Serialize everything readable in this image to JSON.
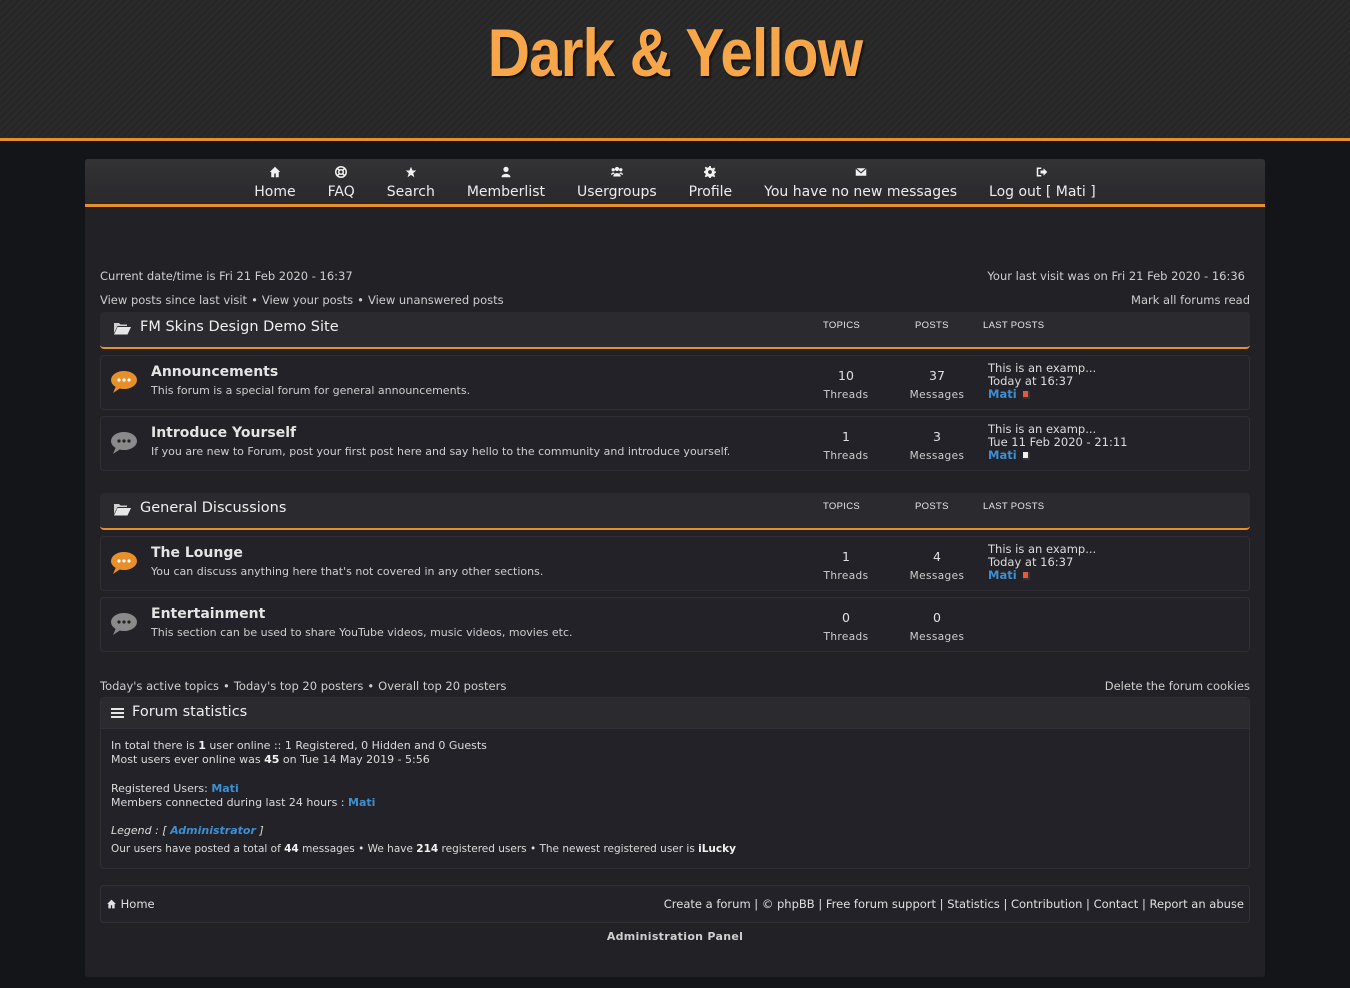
{
  "site": {
    "title": "Dark & Yellow",
    "accent_color": "#e78f2a",
    "title_color": "#f7a64a",
    "link_color": "#3d8fd1"
  },
  "nav": [
    {
      "label": "Home",
      "icon": "home-icon"
    },
    {
      "label": "FAQ",
      "icon": "lifebuoy-icon"
    },
    {
      "label": "Search",
      "icon": "star-icon"
    },
    {
      "label": "Memberlist",
      "icon": "user-icon"
    },
    {
      "label": "Usergroups",
      "icon": "users-icon"
    },
    {
      "label": "Profile",
      "icon": "gear-icon"
    },
    {
      "label": "You have no new messages",
      "icon": "envelope-icon"
    },
    {
      "label": "Log out [ Mati ]",
      "icon": "logout-icon"
    }
  ],
  "info": {
    "current_time": "Current date/time is Fri 21 Feb 2020 - 16:37",
    "last_visit": "Your last visit was on Fri 21 Feb 2020 - 16:36",
    "links": [
      "View posts since last visit",
      "View your posts",
      "View unanswered posts"
    ],
    "mark_read": "Mark all forums read"
  },
  "columns": {
    "topics": "TOPICS",
    "posts": "POSTS",
    "last_posts": "LAST POSTS"
  },
  "categories": [
    {
      "title": "FM Skins Design Demo Site",
      "forums": [
        {
          "name": "Announcements",
          "desc": "This forum is a special forum for general announcements.",
          "unread": true,
          "topics": "10",
          "topics_label": "Threads",
          "posts": "37",
          "posts_label": "Messages",
          "last_title": "This is an examp...",
          "last_date": "Today at 16:37",
          "last_user": "Mati"
        },
        {
          "name": "Introduce Yourself",
          "desc": "If you are new to Forum, post your first post here and say hello to the community and introduce yourself.",
          "unread": false,
          "topics": "1",
          "topics_label": "Threads",
          "posts": "3",
          "posts_label": "Messages",
          "last_title": "This is an examp...",
          "last_date": "Tue 11 Feb 2020 - 21:11",
          "last_user": "Mati"
        }
      ]
    },
    {
      "title": "General Discussions",
      "forums": [
        {
          "name": "The Lounge",
          "desc": "You can discuss anything here that's not covered in any other sections.",
          "unread": true,
          "topics": "1",
          "topics_label": "Threads",
          "posts": "4",
          "posts_label": "Messages",
          "last_title": "This is an examp...",
          "last_date": "Today at 16:37",
          "last_user": "Mati"
        },
        {
          "name": "Entertainment",
          "desc": "This section can be used to share YouTube videos, music videos, movies etc.",
          "unread": false,
          "topics": "0",
          "topics_label": "Threads",
          "posts": "0",
          "posts_label": "Messages"
        }
      ]
    }
  ],
  "bottom_links": {
    "left": [
      "Today's active topics",
      "Today's top 20 posters",
      "Overall top 20 posters"
    ],
    "right": "Delete the forum cookies"
  },
  "stats": {
    "title": "Forum statistics",
    "online_pre": "In total there is ",
    "online_count": "1",
    "online_post": " user online :: 1 Registered, 0 Hidden and 0 Guests",
    "most_pre": "Most users ever online was ",
    "most_count": "45",
    "most_post": " on Tue 14 May 2019 - 5:56",
    "registered_label": "Registered Users: ",
    "registered_user": "Mati",
    "connected_label": "Members connected during last 24 hours : ",
    "connected_user": "Mati",
    "legend_label": "Legend : [ ",
    "legend_group": "Administrator",
    "legend_end": " ]",
    "total_pre": "Our users have posted a total of ",
    "total_messages": "44",
    "total_mid": " messages • We have ",
    "total_users": "214",
    "total_mid2": " registered users • The newest registered user is ",
    "newest_user": "iLucky"
  },
  "footer": {
    "home": "Home",
    "links": [
      "Create a forum",
      "© phpBB",
      "Free forum support",
      "Statistics",
      "Contribution",
      "Contact",
      "Report an abuse"
    ],
    "admin": "Administration Panel"
  }
}
